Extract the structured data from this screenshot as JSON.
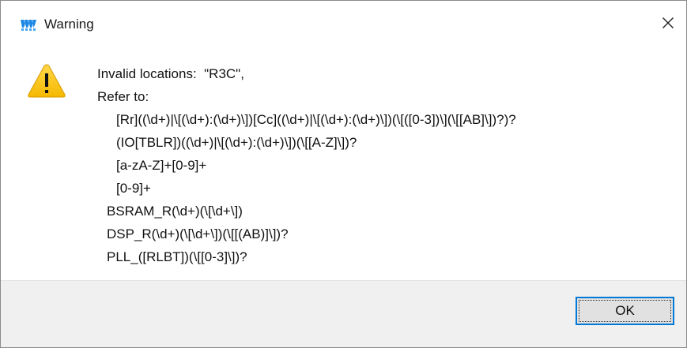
{
  "window": {
    "title": "Warning",
    "close_glyph": "✕",
    "app_icon": "logo-icon",
    "accent_color": "#0078d7"
  },
  "message": {
    "icon": "warning-icon",
    "lines": [
      "Invalid locations:  \"R3C\",",
      "Refer to:",
      "[Rr]((\\d+)|\\[(\\d+):(\\d+)\\])[Cc]((\\d+)|\\[(\\d+):(\\d+)\\])(\\[([0-3])\\](\\[[AB]\\])?)?",
      "(IO[TBLR])((\\d+)|\\[(\\d+):(\\d+)\\])(\\[[A-Z]\\])?",
      "[a-zA-Z]+[0-9]+",
      "[0-9]+",
      "BSRAM_R(\\d+)(\\[\\d+\\])",
      "DSP_R(\\d+)(\\[\\d+\\])(\\[[(AB)]\\])?",
      "PLL_([RLBT])(\\[[0-3]\\])?"
    ]
  },
  "buttons": {
    "ok_label": "OK"
  }
}
